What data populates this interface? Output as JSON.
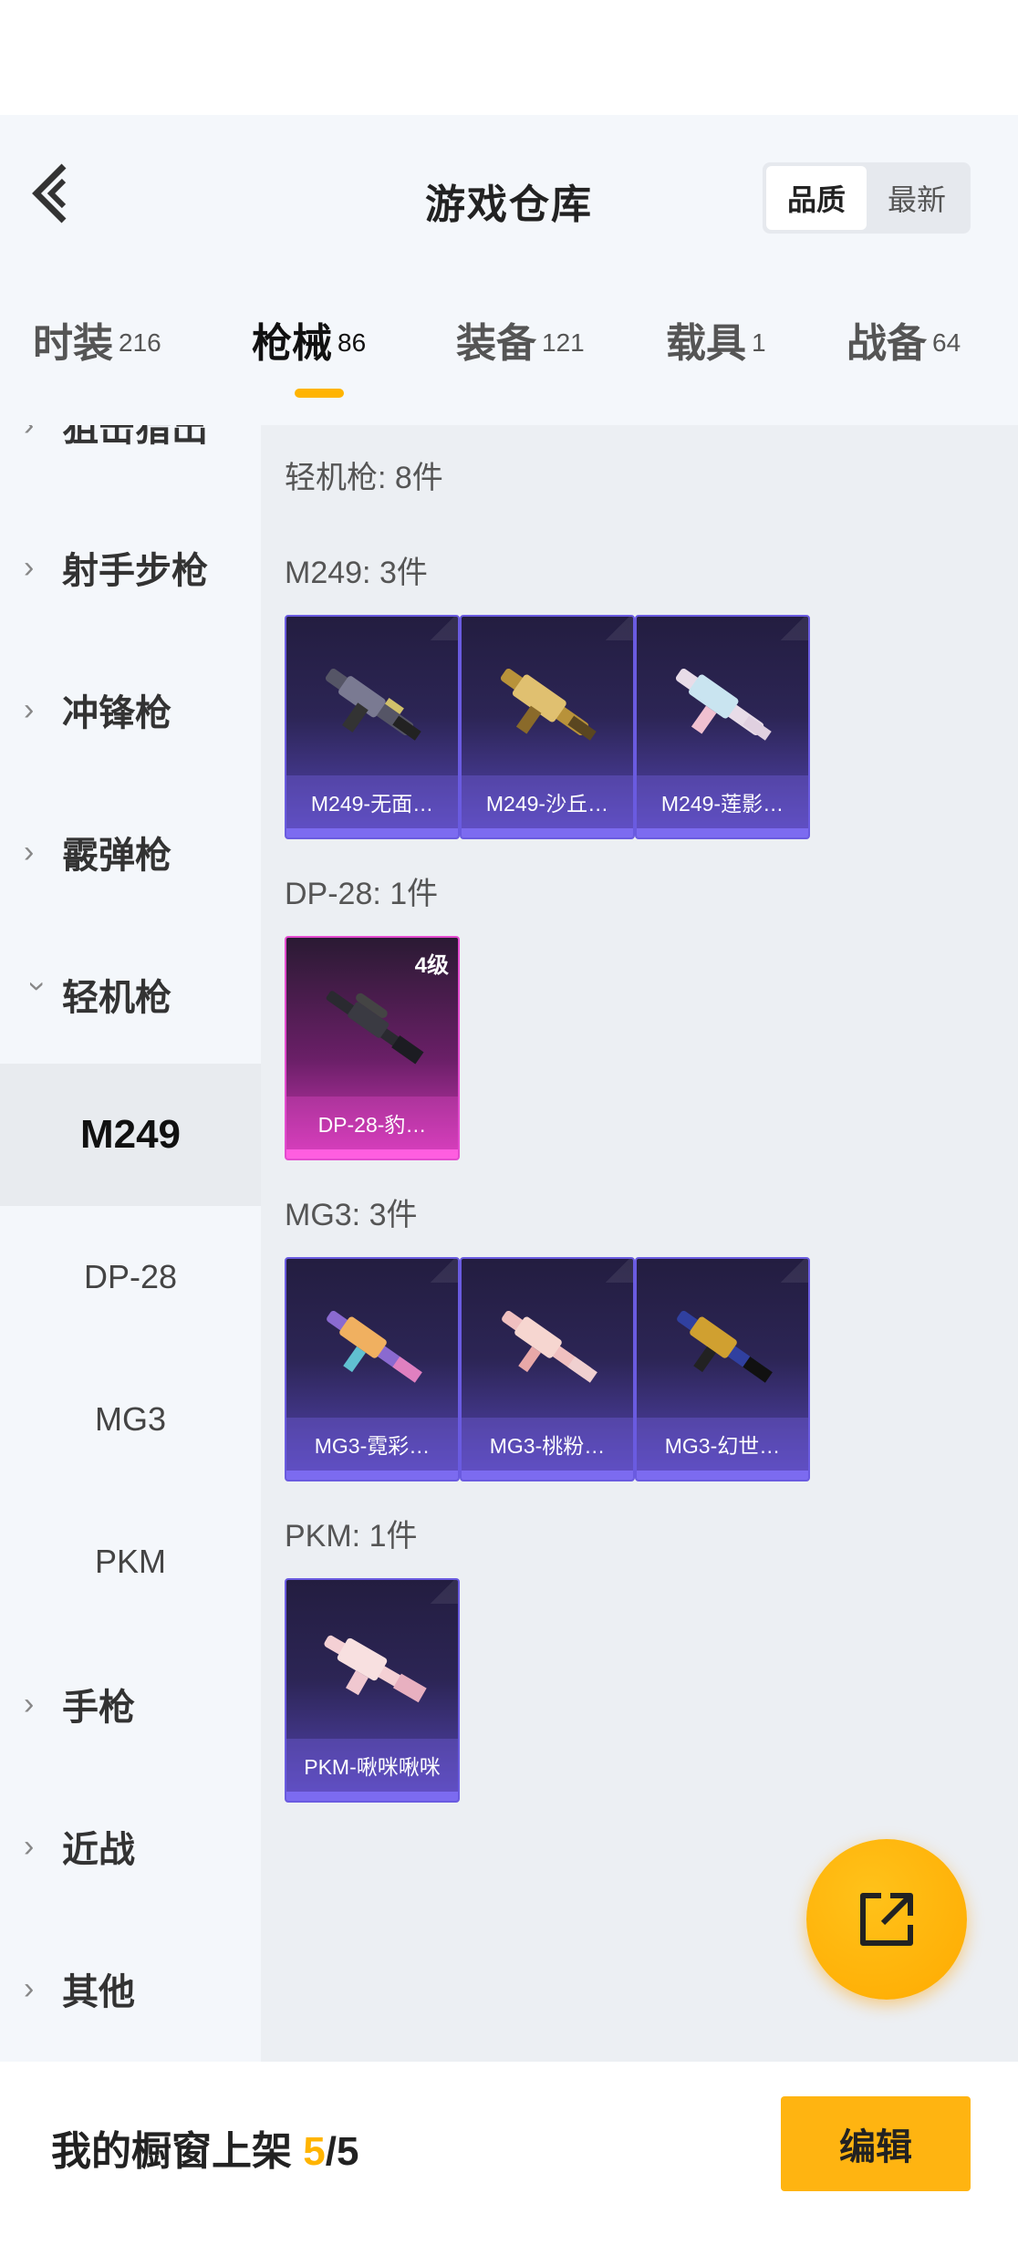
{
  "header": {
    "title": "游戏仓库",
    "sort_options": [
      "品质",
      "最新"
    ],
    "sort_active": "品质"
  },
  "tabs": [
    {
      "label": "时装",
      "count": "216"
    },
    {
      "label": "枪械",
      "count": "86"
    },
    {
      "label": "装备",
      "count": "121"
    },
    {
      "label": "载具",
      "count": "1"
    },
    {
      "label": "战备",
      "count": "64"
    }
  ],
  "active_tab": "枪械",
  "sidebar": {
    "items": [
      {
        "label": "狙击猎出",
        "expanded": false
      },
      {
        "label": "射手步枪",
        "expanded": false
      },
      {
        "label": "冲锋枪",
        "expanded": false
      },
      {
        "label": "霰弹枪",
        "expanded": false
      },
      {
        "label": "轻机枪",
        "expanded": true
      },
      {
        "label": "手枪",
        "expanded": false
      },
      {
        "label": "近战",
        "expanded": false
      },
      {
        "label": "其他",
        "expanded": false
      }
    ],
    "subitems": [
      "M249",
      "DP-28",
      "MG3",
      "PKM"
    ],
    "active_subitem": "M249"
  },
  "content": {
    "category_title": "轻机枪: 8件",
    "groups": [
      {
        "title": "M249: 3件",
        "items": [
          {
            "name": "M249-无面…",
            "rarity": "purple"
          },
          {
            "name": "M249-沙丘…",
            "rarity": "purple"
          },
          {
            "name": "M249-莲影…",
            "rarity": "purple"
          }
        ]
      },
      {
        "title": "DP-28: 1件",
        "items": [
          {
            "name": "DP-28-豹…",
            "rarity": "pink",
            "level": "4级"
          }
        ]
      },
      {
        "title": "MG3: 3件",
        "items": [
          {
            "name": "MG3-霓彩…",
            "rarity": "purple"
          },
          {
            "name": "MG3-桃粉…",
            "rarity": "purple"
          },
          {
            "name": "MG3-幻世…",
            "rarity": "purple"
          }
        ]
      },
      {
        "title": "PKM: 1件",
        "items": [
          {
            "name": "PKM-啾咪啾咪",
            "rarity": "purple"
          }
        ]
      }
    ]
  },
  "fab": {
    "icon": "share-external-icon"
  },
  "footer": {
    "label": "我的橱窗上架",
    "current": "5",
    "separator": "/",
    "total": "5",
    "edit_label": "编辑"
  },
  "colors": {
    "accent": "#ffb400",
    "purple_card": "#5646b8",
    "pink_card": "#d238b8"
  }
}
